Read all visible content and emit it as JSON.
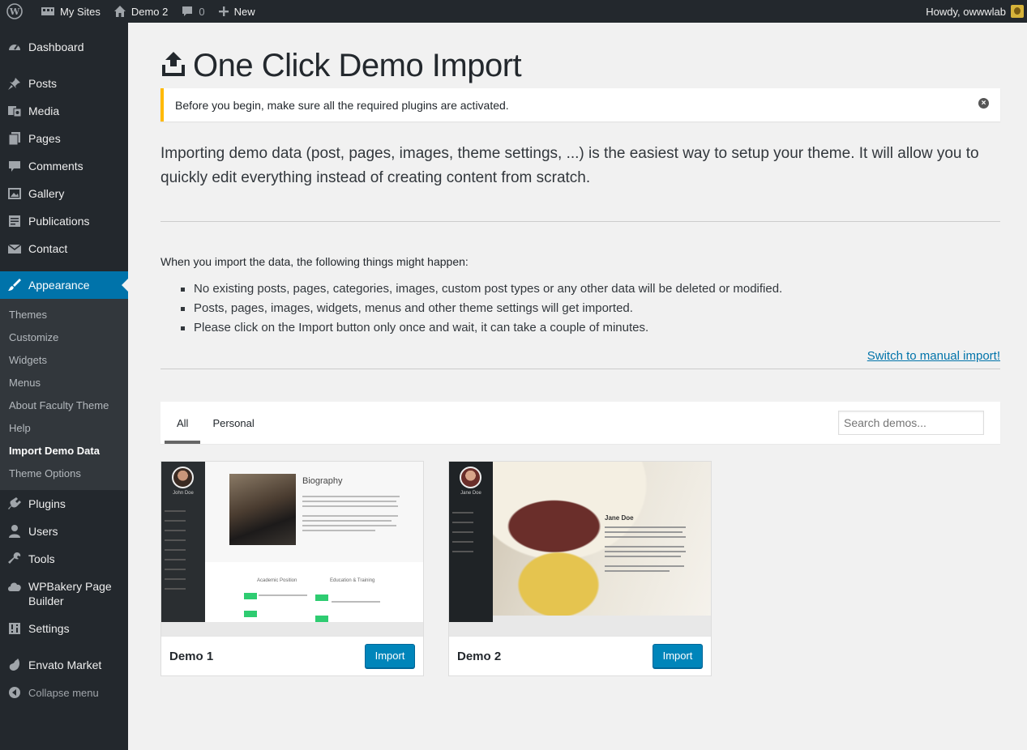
{
  "adminbar": {
    "my_sites": "My Sites",
    "site": "Demo 2",
    "comments_count": "0",
    "new": "New",
    "howdy": "Howdy, owwwlab"
  },
  "sidebar": {
    "items": [
      {
        "label": "Dashboard",
        "icon": "dashboard-icon"
      },
      {
        "label": "Posts",
        "icon": "pin-icon"
      },
      {
        "label": "Media",
        "icon": "media-icon"
      },
      {
        "label": "Pages",
        "icon": "pages-icon"
      },
      {
        "label": "Comments",
        "icon": "comment-icon"
      },
      {
        "label": "Gallery",
        "icon": "gallery-icon"
      },
      {
        "label": "Publications",
        "icon": "publications-icon"
      },
      {
        "label": "Contact",
        "icon": "mail-icon"
      },
      {
        "label": "Appearance",
        "icon": "brush-icon"
      },
      {
        "label": "Plugins",
        "icon": "plugin-icon"
      },
      {
        "label": "Users",
        "icon": "user-icon"
      },
      {
        "label": "Tools",
        "icon": "wrench-icon"
      },
      {
        "label": "WPBakery Page Builder",
        "icon": "cloud-icon"
      },
      {
        "label": "Settings",
        "icon": "settings-icon"
      },
      {
        "label": "Envato Market",
        "icon": "leaf-icon"
      }
    ],
    "submenu": [
      "Themes",
      "Customize",
      "Widgets",
      "Menus",
      "About Faculty Theme",
      "Help",
      "Import Demo Data",
      "Theme Options"
    ],
    "collapse": "Collapse menu"
  },
  "main": {
    "title": "One Click Demo Import",
    "notice": "Before you begin, make sure all the required plugins are activated.",
    "intro": "Importing demo data (post, pages, images, theme settings, ...) is the easiest way to setup your theme. It will allow you to quickly edit everything instead of creating content from scratch.",
    "happen_title": "When you import the data, the following things might happen:",
    "happen_items": [
      "No existing posts, pages, categories, images, custom post types or any other data will be deleted or modified.",
      "Posts, pages, images, widgets, menus and other theme settings will get imported.",
      "Please click on the Import button only once and wait, it can take a couple of minutes."
    ],
    "manual_link": "Switch to manual import!",
    "tabs": [
      "All",
      "Personal"
    ],
    "search_placeholder": "Search demos...",
    "demos": [
      {
        "name": "Demo 1",
        "import": "Import",
        "preview": {
          "person": "John Doe",
          "heading": "Biography",
          "col1": "Academic Position",
          "col2": "Education & Training"
        }
      },
      {
        "name": "Demo 2",
        "import": "Import",
        "preview": {
          "person": "Jane Doe",
          "heading": "Jane Doe"
        }
      }
    ]
  },
  "colors": {
    "accent": "#0073aa",
    "notice_border": "#ffb900",
    "button": "#0085ba",
    "bar": "#23282d"
  }
}
